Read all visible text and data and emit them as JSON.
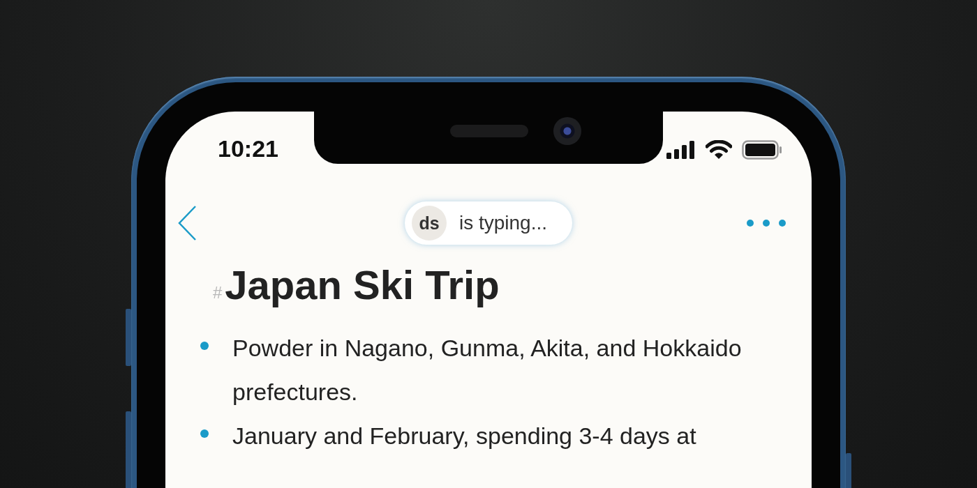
{
  "status_bar": {
    "time": "10:21"
  },
  "nav": {
    "presence": {
      "initials": "ds",
      "text": "is typing..."
    }
  },
  "document": {
    "heading_mark": "#",
    "title": "Japan Ski Trip",
    "bullets": [
      "Powder in Nagano, Gunma, Akita, and Hokkaido prefectures.",
      "January and February, spending 3-4 days at"
    ]
  }
}
